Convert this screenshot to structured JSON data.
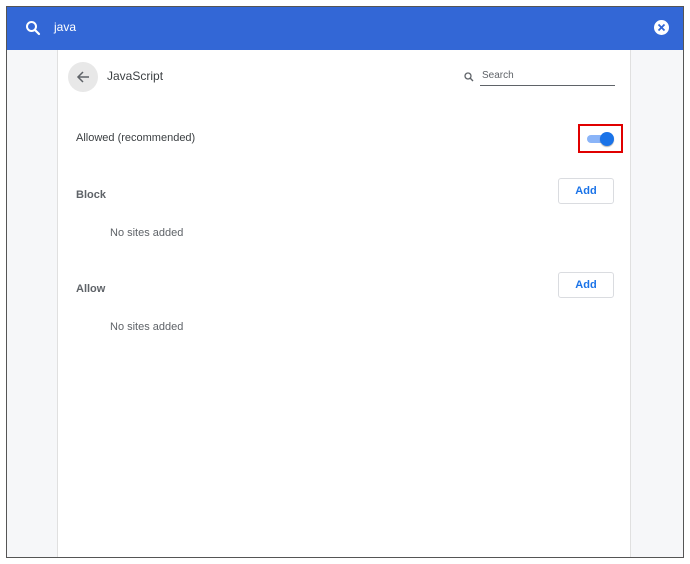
{
  "top_search": {
    "query": "java"
  },
  "header": {
    "title": "JavaScript",
    "search_placeholder": "Search"
  },
  "setting": {
    "label": "Allowed (recommended)",
    "enabled": true
  },
  "sections": [
    {
      "label": "Block",
      "add_label": "Add",
      "empty_text": "No sites added"
    },
    {
      "label": "Allow",
      "add_label": "Add",
      "empty_text": "No sites added"
    }
  ],
  "colors": {
    "topbar": "#3367d6",
    "accent": "#1a73e8",
    "highlight": "#e00000"
  }
}
